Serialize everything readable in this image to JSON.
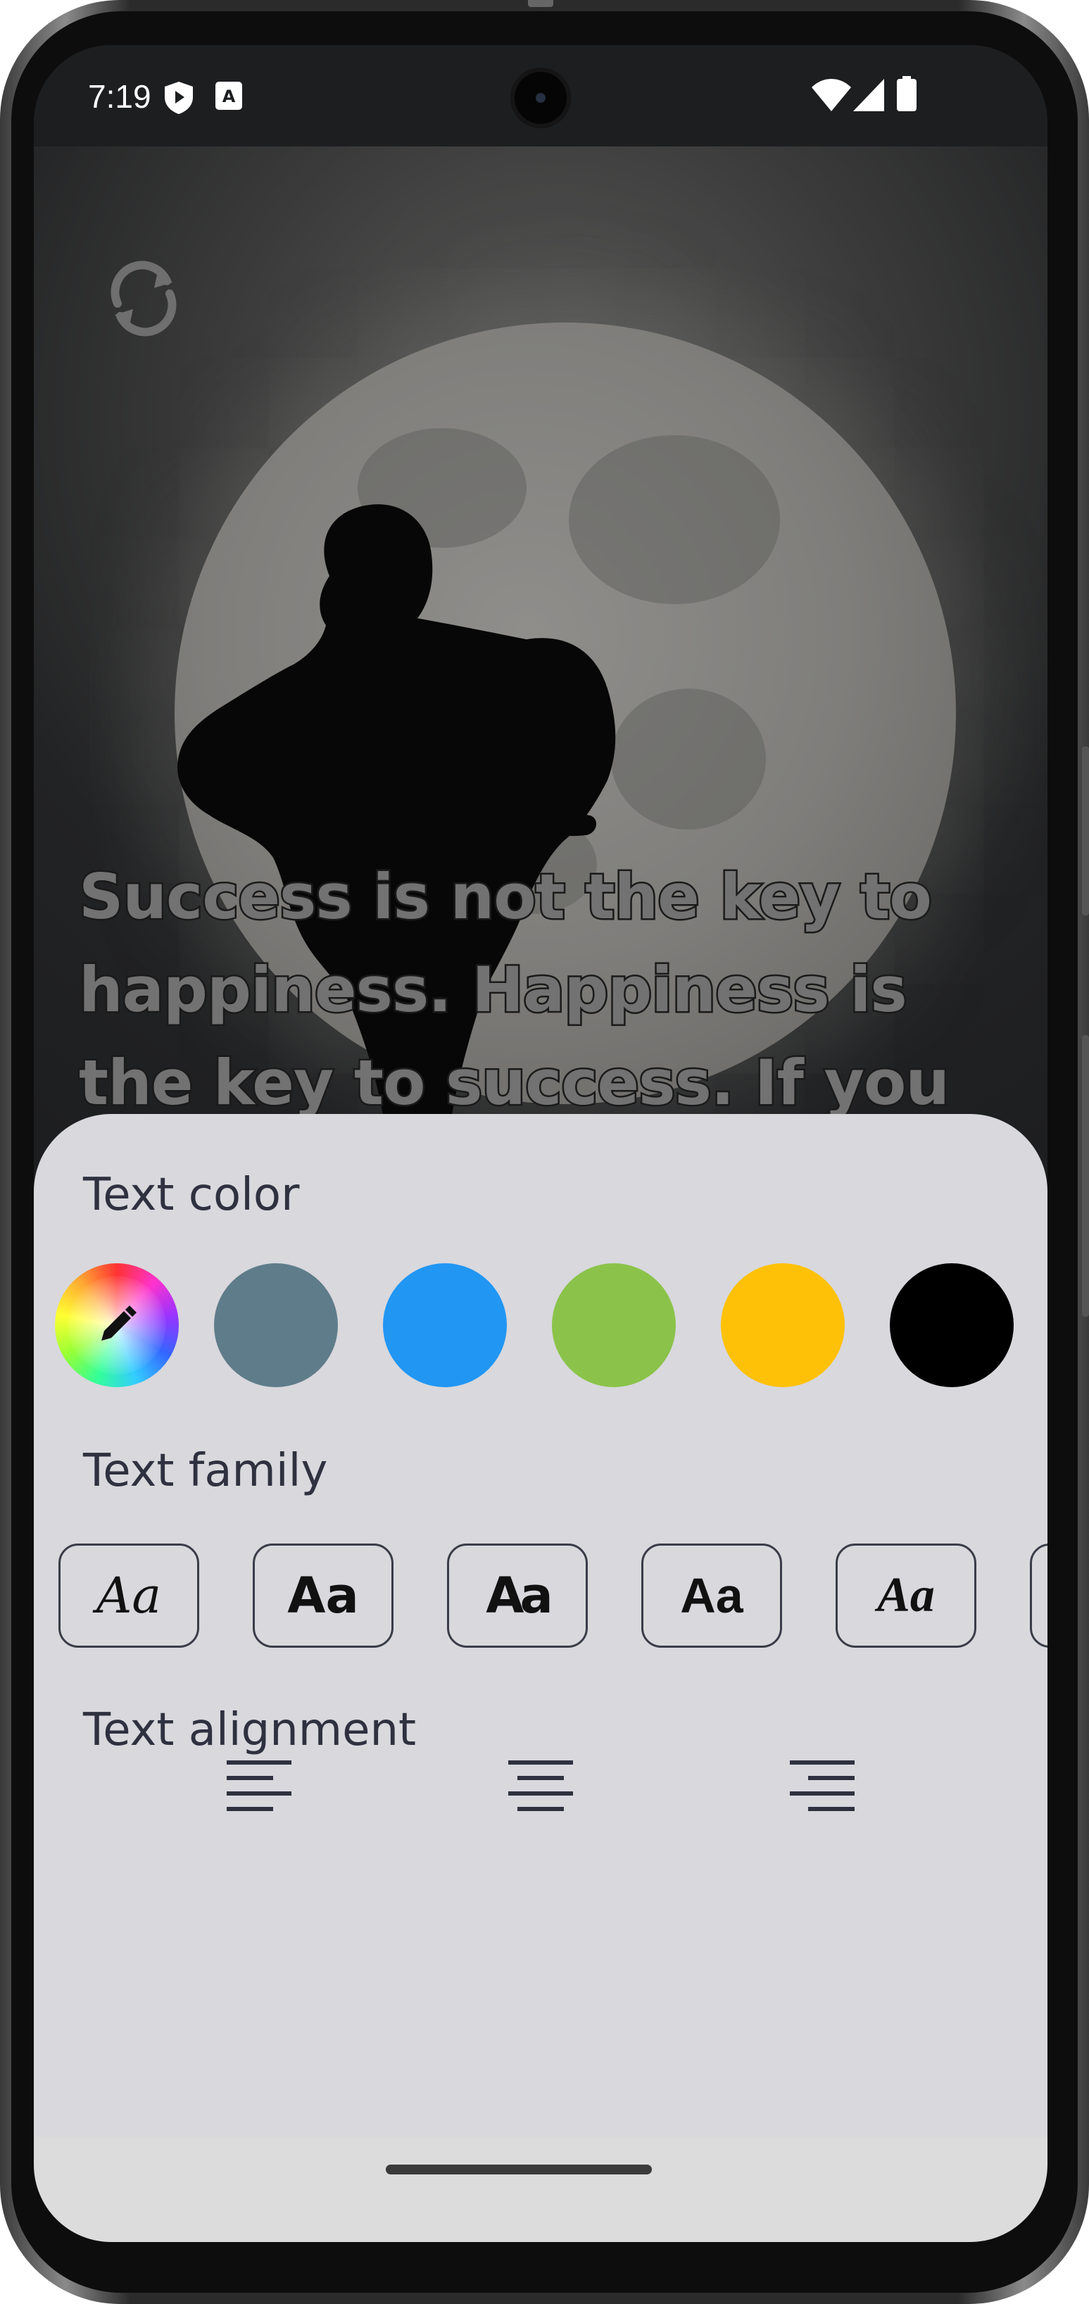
{
  "status_bar": {
    "time": "7:19",
    "icons": [
      "play-protect-icon",
      "keyboard-a-icon",
      "wifi-icon",
      "signal-icon",
      "battery-icon"
    ]
  },
  "preview": {
    "refresh_icon": "refresh-icon",
    "quote_text": "Success is not the key to happiness. Happiness is the key to success. If you"
  },
  "sheet": {
    "text_color_label": "Text color",
    "colors": [
      {
        "name": "custom-color-picker",
        "icon": "pencil-icon"
      },
      {
        "name": "slate",
        "hex": "#5f7c8a"
      },
      {
        "name": "blue",
        "hex": "#2196f3"
      },
      {
        "name": "green",
        "hex": "#8bc34a"
      },
      {
        "name": "amber",
        "hex": "#ffc107"
      },
      {
        "name": "black",
        "hex": "#000000"
      }
    ],
    "text_family_label": "Text family",
    "font_samples": [
      "Aa",
      "Aa",
      "Aa",
      "Aa",
      "Aa"
    ],
    "text_alignment_label": "Text alignment",
    "alignments": [
      "align-left-icon",
      "align-center-icon",
      "align-right-icon"
    ]
  }
}
